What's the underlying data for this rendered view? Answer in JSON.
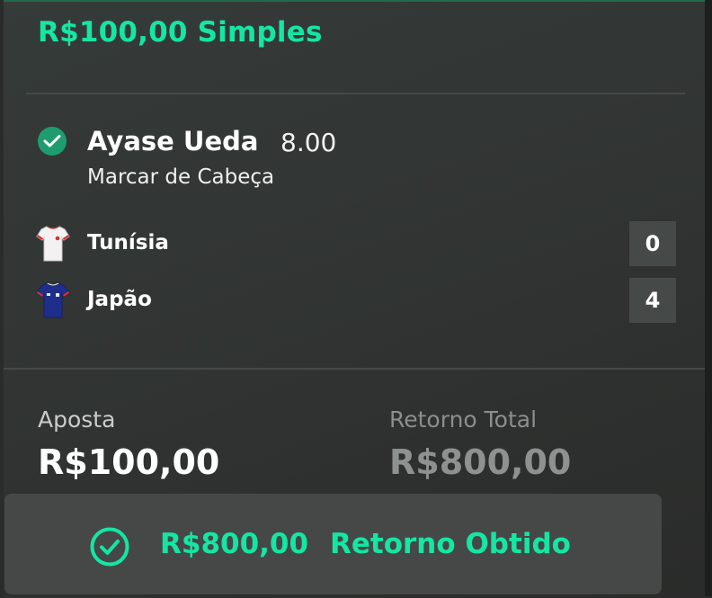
{
  "bet": {
    "title": "R$100,00 Simples",
    "status_icon": "check-circle-icon",
    "status_color": "#1e9c70",
    "accent_color": "#14e6a3"
  },
  "selection": {
    "player": "Ayase Ueda",
    "odds": "8.00",
    "market": "Marcar de Cabeça"
  },
  "match": {
    "teams": [
      {
        "name": "Tunísia",
        "score": "0",
        "shirt_icon": "tunisia-shirt-icon"
      },
      {
        "name": "Japão",
        "score": "4",
        "shirt_icon": "japan-shirt-icon"
      }
    ]
  },
  "summary": {
    "stake_label": "Aposta",
    "stake_value": "R$100,00",
    "return_label": "Retorno Total",
    "return_value": "R$800,00"
  },
  "result": {
    "amount": "R$800,00",
    "text": "Retorno Obtido",
    "icon": "check-circle-outline-icon"
  }
}
